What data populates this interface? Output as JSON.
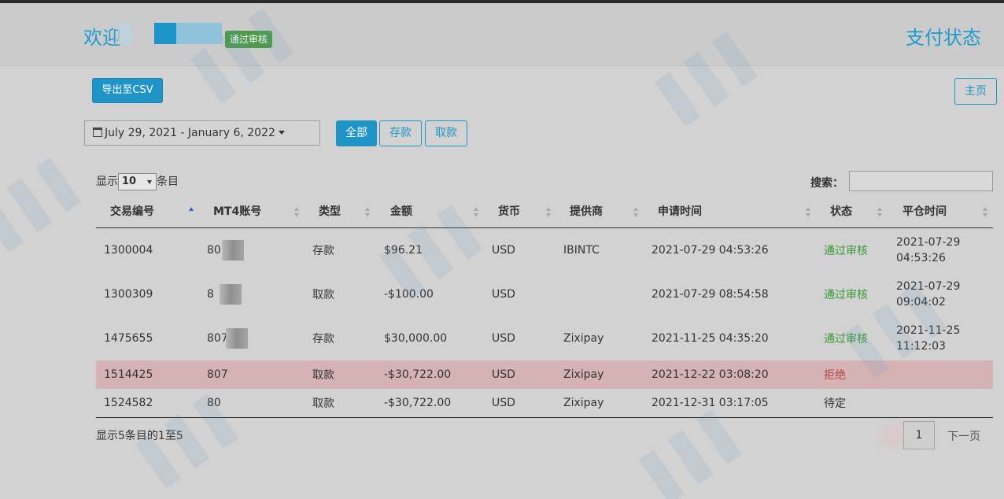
{
  "header": {
    "welcome": "欢迎",
    "badge": "通过审核",
    "title": "支付状态"
  },
  "toolbar": {
    "export_label": "导出至CSV",
    "home_label": "主页",
    "date_range": "July 29, 2021 - January 6, 2022",
    "filters": [
      "全部",
      "存款",
      "取款"
    ]
  },
  "table_controls": {
    "show_prefix": "显示",
    "page_size": "10",
    "show_suffix": "条目",
    "search_label": "搜索："
  },
  "table": {
    "columns": [
      "交易编号",
      "MT4账号",
      "类型",
      "金额",
      "货币",
      "提供商",
      "申请时间",
      "状态",
      "平仓时间"
    ],
    "rows": [
      {
        "id": "1300004",
        "account": "80",
        "type": "存款",
        "amount": "$96.21",
        "currency": "USD",
        "provider": "IBINTC",
        "requested": "2021-07-29 04:53:26",
        "status": "通过审核",
        "closed_date": "2021-07-29",
        "closed_time": "04:53:26"
      },
      {
        "id": "1300309",
        "account": "8",
        "type": "取款",
        "amount": "-$100.00",
        "currency": "USD",
        "provider": "",
        "requested": "2021-07-29 08:54:58",
        "status": "通过审核",
        "closed_date": "2021-07-29",
        "closed_time": "09:04:02"
      },
      {
        "id": "1475655",
        "account": "807",
        "type": "存款",
        "amount": "$30,000.00",
        "currency": "USD",
        "provider": "Zixipay",
        "requested": "2021-11-25 04:35:20",
        "status": "通过审核",
        "closed_date": "2021-11-25",
        "closed_time": "11:12:03"
      },
      {
        "id": "1514425",
        "account": "807",
        "type": "取款",
        "amount": "-$30,722.00",
        "currency": "USD",
        "provider": "Zixipay",
        "requested": "2021-12-22 03:08:20",
        "status": "拒绝",
        "closed_date": "",
        "closed_time": ""
      },
      {
        "id": "1524582",
        "account": "80",
        "type": "取款",
        "amount": "-$30,722.00",
        "currency": "USD",
        "provider": "Zixipay",
        "requested": "2021-12-31 03:17:05",
        "status": "待定",
        "closed_date": "",
        "closed_time": ""
      }
    ]
  },
  "footer": {
    "info": "显示5条目的1至5",
    "current_page": "1",
    "next_label": "下一页"
  },
  "colors": {
    "accent": "#1f94c7",
    "approved": "#3a9a35",
    "rejected": "#b2443f",
    "rejected_row": "#d5b3b4"
  }
}
